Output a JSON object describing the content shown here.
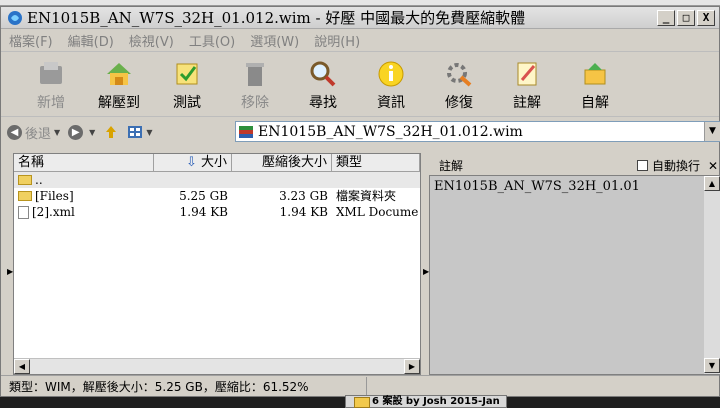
{
  "window": {
    "title": "EN1015B_AN_W7S_32H_01.012.wim - 好壓 中國最大的免費壓縮軟體",
    "minimize": "_",
    "maximize": "□",
    "close": "X"
  },
  "menu": [
    "檔案(F)",
    "編輯(D)",
    "檢視(V)",
    "工具(O)",
    "選項(W)",
    "說明(H)"
  ],
  "toolbar": [
    {
      "label": "新增",
      "icon": "add-icon",
      "enabled": false
    },
    {
      "label": "解壓到",
      "icon": "extract-icon",
      "enabled": true
    },
    {
      "label": "測試",
      "icon": "test-icon",
      "enabled": true
    },
    {
      "label": "移除",
      "icon": "trash-icon",
      "enabled": false
    },
    {
      "label": "尋找",
      "icon": "magnifier-icon",
      "enabled": true
    },
    {
      "label": "資訊",
      "icon": "info-icon",
      "enabled": true
    },
    {
      "label": "修復",
      "icon": "repair-icon",
      "enabled": true
    },
    {
      "label": "註解",
      "icon": "comment-icon",
      "enabled": true
    },
    {
      "label": "自解",
      "icon": "sfx-icon",
      "enabled": true
    }
  ],
  "addressbar": {
    "back_label": "後退",
    "path": "EN1015B_AN_W7S_32H_01.012.wim"
  },
  "filelist": {
    "columns": {
      "name": "名稱",
      "size": "大小",
      "packed": "壓縮後大小",
      "type": "類型"
    },
    "rows": [
      {
        "name": "..",
        "size": "",
        "packed": "",
        "type": "",
        "kind": "folder"
      },
      {
        "name": "[Files]",
        "size": "5.25 GB",
        "packed": "3.23 GB",
        "type": "檔案資料夾",
        "kind": "folder"
      },
      {
        "name": "[2].xml",
        "size": "1.94 KB",
        "packed": "1.94 KB",
        "type": "XML Docume",
        "kind": "file"
      }
    ]
  },
  "comment": {
    "title": "註解",
    "wrap_label": "自動換行",
    "text": "EN1015B_AN_W7S_32H_01.01"
  },
  "status": {
    "text": "類型：WIM，解壓後大小：5.25 GB，壓縮比：61.52%"
  },
  "background": {
    "item": "6 案設 by Josh 2015-Jan"
  }
}
